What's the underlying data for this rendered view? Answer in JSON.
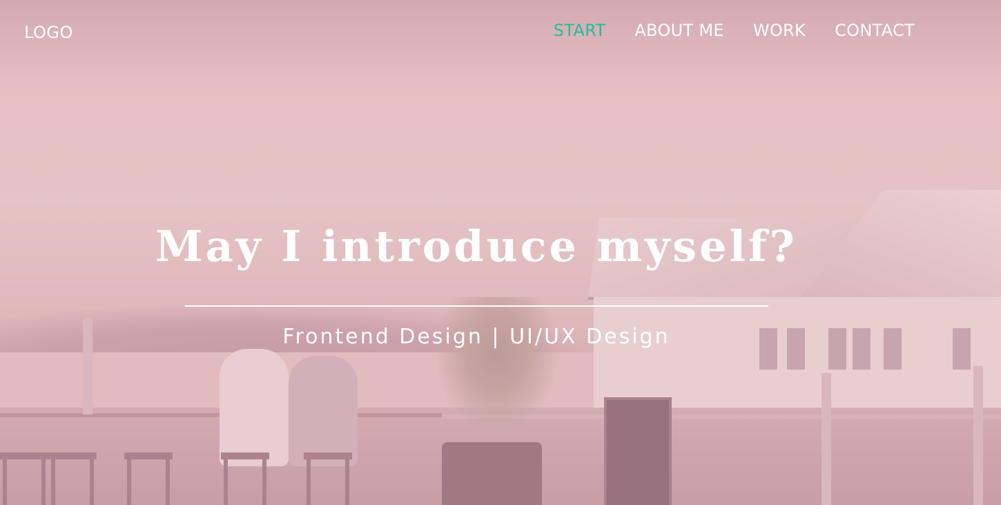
{
  "header": {
    "logo": "LOGO",
    "nav": [
      {
        "label": "START",
        "active": true
      },
      {
        "label": "ABOUT ME",
        "active": false
      },
      {
        "label": "WORK",
        "active": false
      },
      {
        "label": "CONTACT",
        "active": false
      }
    ]
  },
  "hero": {
    "title": "May I introduce myself?",
    "subtitle": "Frontend Design | UI/UX Design"
  },
  "colors": {
    "accent": "#1fbf9a",
    "overlay": "#e6b9c3",
    "text": "#ffffff"
  }
}
